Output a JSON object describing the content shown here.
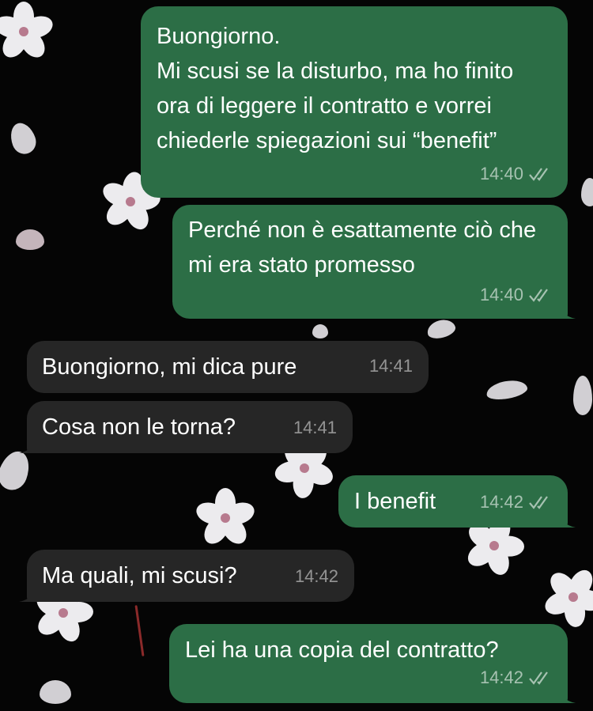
{
  "messages": [
    {
      "direction": "outgoing",
      "text": "Buongiorno.\nMi scusi se la disturbo, ma ho finito ora di leggere il contratto e vorrei chiederle spiegazioni sui “benefit”",
      "time": "14:40",
      "status_icon": "double-check-icon"
    },
    {
      "direction": "outgoing",
      "text": "Perché non è esattamente ciò che mi era stato promesso",
      "time": "14:40",
      "status_icon": "double-check-icon"
    },
    {
      "direction": "incoming",
      "text": "Buongiorno, mi dica pure",
      "time": "14:41"
    },
    {
      "direction": "incoming",
      "text": "Cosa non le torna?",
      "time": "14:41"
    },
    {
      "direction": "outgoing",
      "text": "I benefit",
      "time": "14:42",
      "status_icon": "double-check-icon"
    },
    {
      "direction": "incoming",
      "text": "Ma quali, mi scusi?",
      "time": "14:42"
    },
    {
      "direction": "outgoing",
      "text": "Lei ha una copia del contratto?",
      "time": "14:42",
      "status_icon": "double-check-icon"
    }
  ],
  "colors": {
    "outgoing_bubble": "#2c6e46",
    "incoming_bubble": "#262626",
    "background": "#050505",
    "wallpaper": "cherry-blossom-pattern"
  }
}
